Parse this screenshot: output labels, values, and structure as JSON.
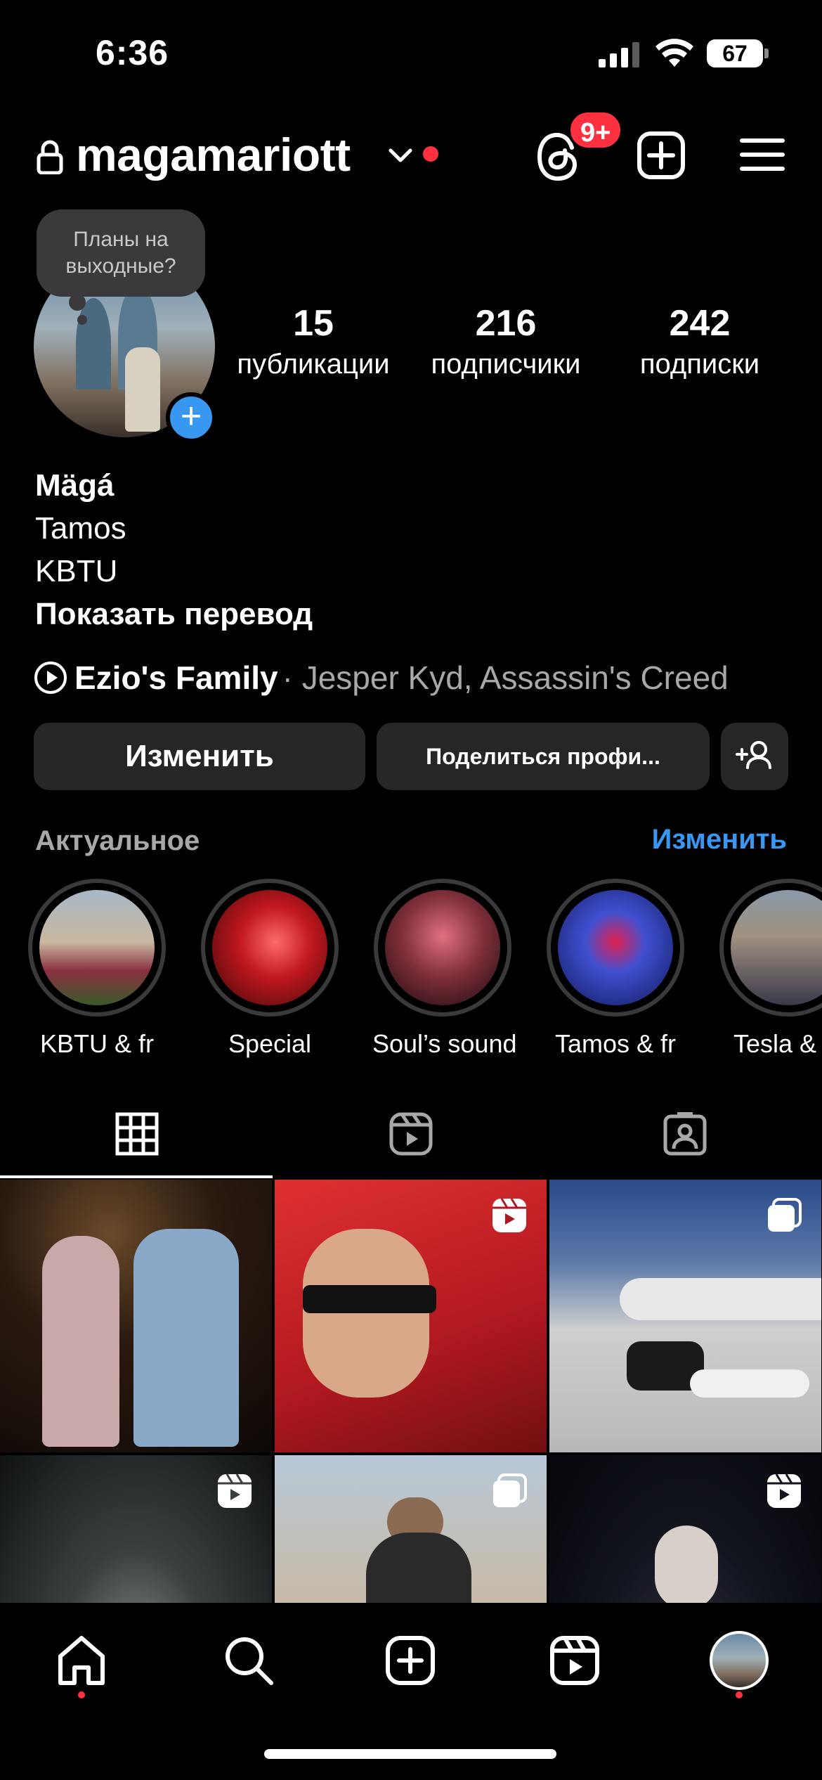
{
  "status_bar": {
    "time": "6:36",
    "battery": "67"
  },
  "header": {
    "username": "magamariott",
    "threads_badge": "9+"
  },
  "profile": {
    "note": "Планы на выходные?",
    "stats": [
      {
        "value": "15",
        "label": "публикации"
      },
      {
        "value": "216",
        "label": "подписчики"
      },
      {
        "value": "242",
        "label": "подписки"
      }
    ],
    "name": "Mägá",
    "bio_lines": [
      "Tamos",
      "KBTU"
    ],
    "translate_label": "Показать перевод",
    "music": {
      "song": "Ezio's Family",
      "artist": "· Jesper Kyd, Assassin's Creed"
    }
  },
  "actions": {
    "edit_label": "Изменить",
    "share_label": "Поделиться профи..."
  },
  "highlights": {
    "title": "Актуальное",
    "edit_label": "Изменить",
    "items": [
      {
        "label": "KBTU & fr"
      },
      {
        "label": "Special"
      },
      {
        "label": "Soul’s sound"
      },
      {
        "label": "Tamos & fr"
      },
      {
        "label": "Tesla &"
      }
    ]
  },
  "tabs": [
    "grid-icon",
    "reels-icon",
    "tagged-icon"
  ],
  "grid_posts": [
    {
      "type": "photo"
    },
    {
      "type": "reel"
    },
    {
      "type": "carousel"
    },
    {
      "type": "reel"
    },
    {
      "type": "carousel"
    },
    {
      "type": "reel"
    }
  ],
  "bottom_nav": [
    "home-icon",
    "search-icon",
    "create-icon",
    "reels-icon",
    "profile-avatar"
  ],
  "colors": {
    "accent": "#3897f0",
    "badge": "#ff3040",
    "button_bg": "#262626"
  }
}
